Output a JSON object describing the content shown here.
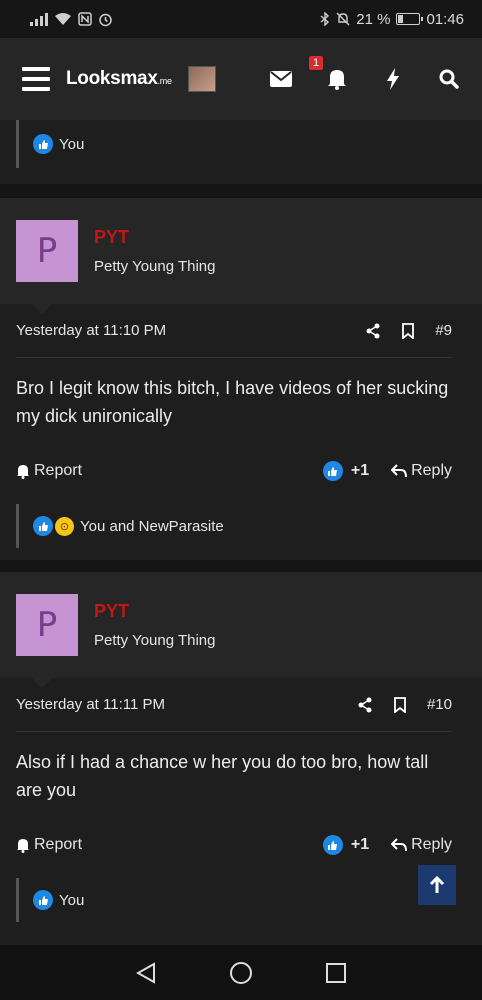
{
  "status": {
    "battery": "21 %",
    "time": "01:46"
  },
  "header": {
    "logo": "Looksmax",
    "logo_suffix": ".me",
    "notif_count": "1"
  },
  "top_reaction": {
    "text": "You"
  },
  "posts": [
    {
      "avatar_letter": "P",
      "username": "PYT",
      "user_title": "Petty Young Thing",
      "time": "Yesterday at 11:10 PM",
      "number": "#9",
      "message": "Bro I legit know this bitch, I have videos of her sucking my dick unironically",
      "report": "Report",
      "likes": "+1",
      "reply": "Reply",
      "reactions": "You and NewParasite"
    },
    {
      "avatar_letter": "P",
      "username": "PYT",
      "user_title": "Petty Young Thing",
      "time": "Yesterday at 11:11 PM",
      "number": "#10",
      "message": "Also if I had a chance w her you do too bro, how tall are you",
      "report": "Report",
      "likes": "+1",
      "reply": "Reply",
      "reactions": "You"
    }
  ],
  "colors": {
    "username": "#c01818",
    "like": "#1e88e5",
    "badge": "#d32f2f",
    "scrolltop": "#1c3a70"
  }
}
